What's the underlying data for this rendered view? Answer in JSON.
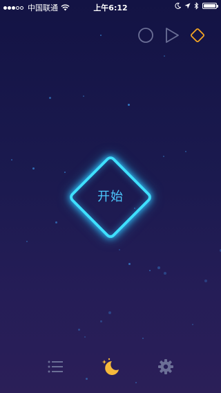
{
  "status_bar": {
    "carrier": "中国联通",
    "time": "上午6:12"
  },
  "mode_buttons": {
    "circle_icon": "circle-icon",
    "triangle_icon": "play-triangle-icon",
    "diamond_icon": "diamond-icon",
    "active_mode": "diamond"
  },
  "main": {
    "start_label": "开始"
  },
  "bottom_bar": {
    "list_icon": "list-icon",
    "night_icon": "moon-stars-icon",
    "settings_icon": "gear-icon"
  },
  "colors": {
    "accent_cyan": "#3fe0ff",
    "label_blue": "#4cc8ff",
    "active_orange": "#f5a623",
    "inactive_gray": "#6b6f96",
    "moon_yellow": "#f6b93b"
  }
}
